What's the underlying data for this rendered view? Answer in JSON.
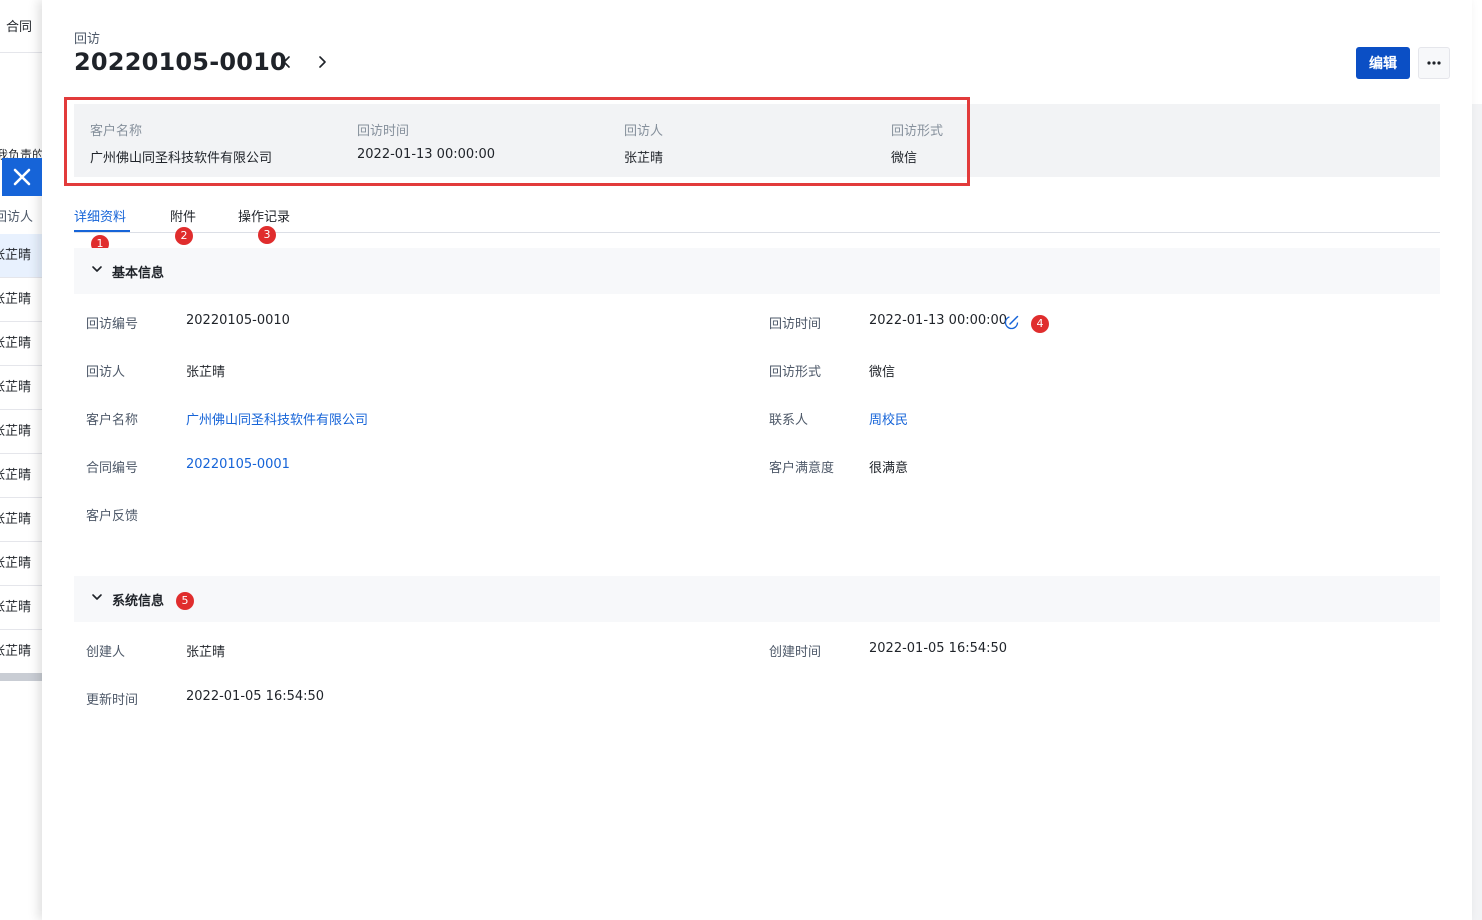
{
  "background_list": {
    "tab_label": "合同",
    "cut_text": "我负责的",
    "column_header": "回访人",
    "rows": [
      "张芷晴",
      "张芷晴",
      "张芷晴",
      "张芷晴",
      "张芷晴",
      "张芷晴",
      "张芷晴",
      "张芷晴",
      "张芷晴",
      "张芷晴"
    ]
  },
  "header": {
    "entity_type": "回访",
    "record_id": "20220105-0010",
    "edit_label": "编辑"
  },
  "summary": {
    "customer_label": "客户名称",
    "customer_value": "广州佛山同圣科技软件有限公司",
    "time_label": "回访时间",
    "time_value": "2022-01-13 00:00:00",
    "visitor_label": "回访人",
    "visitor_value": "张芷晴",
    "form_label": "回访形式",
    "form_value": "微信"
  },
  "tabs": [
    "详细资料",
    "附件",
    "操作记录"
  ],
  "badges": [
    "1",
    "2",
    "3",
    "4",
    "5"
  ],
  "basic_info": {
    "title": "基本信息",
    "visit_no_label": "回访编号",
    "visit_no_value": "20220105-0010",
    "visit_time_label": "回访时间",
    "visit_time_value": "2022-01-13 00:00:00",
    "visitor_label": "回访人",
    "visitor_value": "张芷晴",
    "visit_form_label": "回访形式",
    "visit_form_value": "微信",
    "customer_label": "客户名称",
    "customer_value": "广州佛山同圣科技软件有限公司",
    "contact_label": "联系人",
    "contact_value": "周校民",
    "contract_label": "合同编号",
    "contract_value": "20220105-0001",
    "satisfaction_label": "客户满意度",
    "satisfaction_value": "很满意",
    "feedback_label": "客户反馈",
    "feedback_value": ""
  },
  "system_info": {
    "title": "系统信息",
    "creator_label": "创建人",
    "creator_value": "张芷晴",
    "created_label": "创建时间",
    "created_value": "2022-01-05 16:54:50",
    "updated_label": "更新时间",
    "updated_value": "2022-01-05 16:54:50"
  },
  "colors": {
    "primary": "#1664d8",
    "edit_button": "#0b4fc5",
    "badge": "#e02d2d",
    "highlight_border": "#e23b3b"
  }
}
